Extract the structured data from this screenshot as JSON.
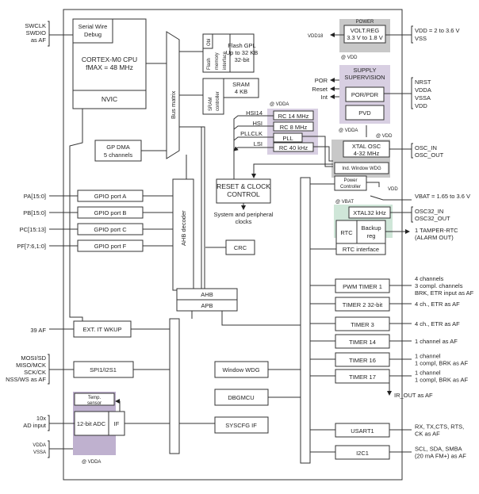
{
  "colors": {
    "power_gray": "#c8c8c8",
    "supervision_purple": "#d8cfe2",
    "osc_purple": "#d8cfe2",
    "xtal_gray": "#c8c8c8",
    "rtc_green": "#cfe6d8",
    "adc_purple": "#bfb1cf"
  },
  "external_left": {
    "swd": [
      "SWCLK",
      "SWDIO",
      "as AF"
    ],
    "pa": "PA[15:0]",
    "pb": "PB[15:0]",
    "pc": "PC[15:13]",
    "pf": "PF[7:6,1:0]",
    "af39": "39 AF",
    "spi": [
      "MOSI/SD",
      "MISO/MCK",
      "SCK/CK",
      "NSS/WS as AF"
    ],
    "adc_in": [
      "10x",
      "AD input"
    ],
    "vdda_vssa": [
      "VDDA",
      "VSSA"
    ]
  },
  "core": {
    "swd": [
      "Serial Wire",
      "Debug"
    ],
    "cpu": "CORTEX-M0 CPU",
    "fmax": "fMAX = 48 MHz",
    "nvic": "NVIC",
    "bus_matrix": "Bus matrix",
    "dma": [
      "GP DMA",
      "5 channels"
    ],
    "ahb_decoder": "AHB decoder"
  },
  "memory": {
    "obl": "Obl",
    "flash_if": [
      "Flash",
      "memory",
      "interface"
    ],
    "flash": [
      "Flash GPL",
      "Up to 32 KB",
      "32-bit"
    ],
    "sram_ctrl": [
      "SRAM",
      "controller"
    ],
    "sram": [
      "SRAM",
      "4 KB"
    ]
  },
  "gpio": [
    "GPIO port A",
    "GPIO port B",
    "GPIO port C",
    "GPIO port F"
  ],
  "power": {
    "title": "POWER",
    "volt_reg": [
      "VOLT.REG",
      "3.3 V to 1.8 V"
    ],
    "vdd18": "VDD18",
    "at_vdd": "@ VDD",
    "vdd_range": "VDD = 2 to 3.6 V",
    "vss": "VSS"
  },
  "supervision": {
    "title": [
      "SUPPLY",
      "SUPERVISION"
    ],
    "por_pdr": "POR/PDR",
    "pvd": "PVD",
    "outputs": [
      "POR",
      "Reset",
      "Int"
    ],
    "pins": [
      "NRST",
      "VDDA",
      "VSSA",
      "VDD"
    ],
    "at_vdda": "@ VDDA",
    "at_vdd": "@ VDD"
  },
  "clocks": {
    "at_vdda": "@ VDDA",
    "signals": [
      "HSI14",
      "HSI",
      "PLLCLK",
      "LSI"
    ],
    "sources": [
      "RC 14 MHz",
      "RC 8 MHz",
      "PLL",
      "RC 40 kHz"
    ],
    "rcc": [
      "RESET & CLOCK",
      "CONTROL"
    ],
    "rcc_out": [
      "System and peripheral",
      "clocks"
    ],
    "xtal_osc": [
      "XTAL OSC",
      "4-32 MHz"
    ],
    "osc_pins": [
      "OSC_IN",
      "OSC_OUT"
    ],
    "iwdg": "Ind. Window WDG",
    "power_ctrl": [
      "Power",
      "Controller"
    ],
    "vdd": "VDD",
    "vbat_range": "VBAT = 1.65 to 3.6 V",
    "at_vbat": "@ VBAT",
    "xtal32": "XTAL32 kHz",
    "osc32_pins": [
      "OSC32_IN",
      "OSC32_OUT"
    ],
    "rtc": "RTC",
    "backup": [
      "Backup",
      "reg"
    ],
    "rtc_if": "RTC interface",
    "tamper": [
      "1 TAMPER-RTC",
      "(ALARM OUT)"
    ]
  },
  "misc": {
    "crc": "CRC",
    "ahb": "AHB",
    "apb": "APB",
    "exti": "EXT. IT  WKUP",
    "spi": "SPI1/I2S1",
    "temp": [
      "Temp.",
      "sensor"
    ],
    "adc": "12-bit ADC",
    "if": "IF",
    "at_vdda": "@ VDDA",
    "wwdg": "Window WDG",
    "dbgmcu": "DBGMCU",
    "syscfg": "SYSCFG IF"
  },
  "peripherals": [
    {
      "name": "PWM TIMER 1",
      "pins": [
        "4 channels",
        "3 compl. channels",
        "BRK, ETR input as AF"
      ]
    },
    {
      "name": "TIMER 2 32-bit",
      "pins": [
        "4 ch., ETR as AF"
      ]
    },
    {
      "name": "TIMER 3",
      "pins": [
        "4 ch., ETR as AF"
      ]
    },
    {
      "name": "TIMER 14",
      "pins": [
        "1 channel as AF"
      ]
    },
    {
      "name": "TIMER 16",
      "pins": [
        "1 channel",
        "1 compl, BRK as AF"
      ]
    },
    {
      "name": "TIMER 17",
      "pins": [
        "1 channel",
        "1 compl, BRK as AF"
      ]
    },
    {
      "name": "USART1",
      "pins": [
        "RX, TX,CTS, RTS,",
        "CK as AF"
      ]
    },
    {
      "name": "I2C1",
      "pins": [
        "SCL, SDA, SMBA",
        "(20 mA FM+) as AF"
      ]
    }
  ],
  "ir_out": "IR_OUT as AF"
}
